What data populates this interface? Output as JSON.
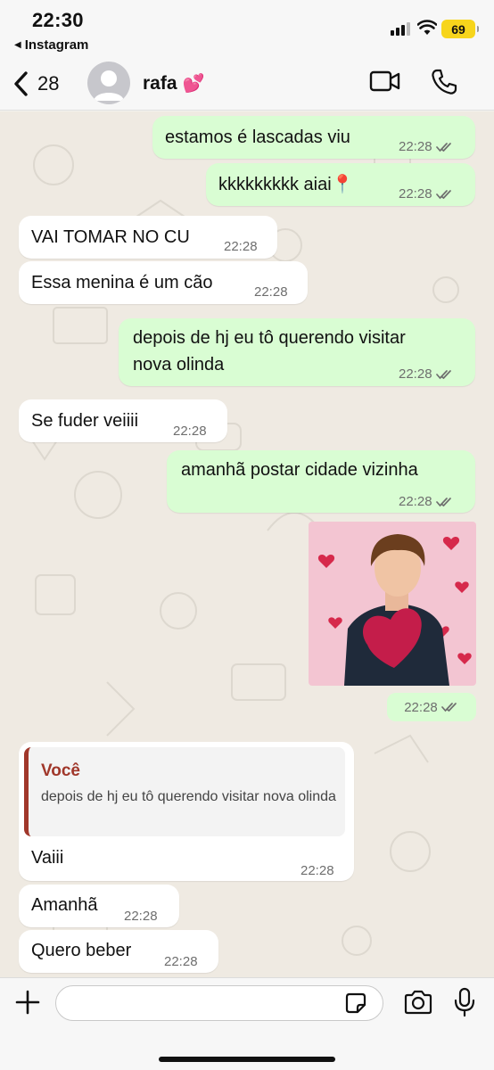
{
  "status_bar": {
    "time": "22:30",
    "back_app": "Instagram",
    "battery": "69",
    "battery_color": "#f7d51c"
  },
  "header": {
    "back_count": "28",
    "contact_name": "rafa",
    "name_emoji": "💕",
    "icons": [
      "chevron-left-icon",
      "video-camera-icon",
      "phone-icon"
    ]
  },
  "messages": [
    {
      "direction": "out",
      "text": "estamos é lascadas viu",
      "time": "22:28",
      "status": "read"
    },
    {
      "direction": "out",
      "text": "kkkkkkkkk aiai📍",
      "time": "22:28",
      "status": "read"
    },
    {
      "direction": "in",
      "text": "VAI TOMAR NO CU",
      "time": "22:28"
    },
    {
      "direction": "in",
      "text": "Essa menina é um cão",
      "time": "22:28"
    },
    {
      "direction": "out",
      "text": "depois de hj eu tô querendo visitar",
      "text2": "nova olinda",
      "time": "22:28",
      "status": "read"
    },
    {
      "direction": "in",
      "text": "Se fuder veiiii",
      "time": "22:28"
    },
    {
      "direction": "out",
      "text": "amanhã postar cidade vizinha",
      "time": "22:28",
      "status": "read"
    },
    {
      "direction": "out",
      "type": "image",
      "time": "22:28",
      "status": "read"
    },
    {
      "direction": "in",
      "quote_author": "Você",
      "quote_text": "depois de hj eu tô querendo visitar nova olinda",
      "text": "Vaiii",
      "time": "22:28"
    },
    {
      "direction": "in",
      "text": "Amanhã",
      "time": "22:28"
    },
    {
      "direction": "in",
      "text": "Quero beber",
      "time": "22:28"
    }
  ],
  "input": {
    "value": "",
    "placeholder": ""
  },
  "colors": {
    "outgoing_bubble": "#d9fdd3",
    "incoming_bubble": "#ffffff",
    "read_check": "#6e6e6e",
    "quote_accent": "#a0372a"
  }
}
